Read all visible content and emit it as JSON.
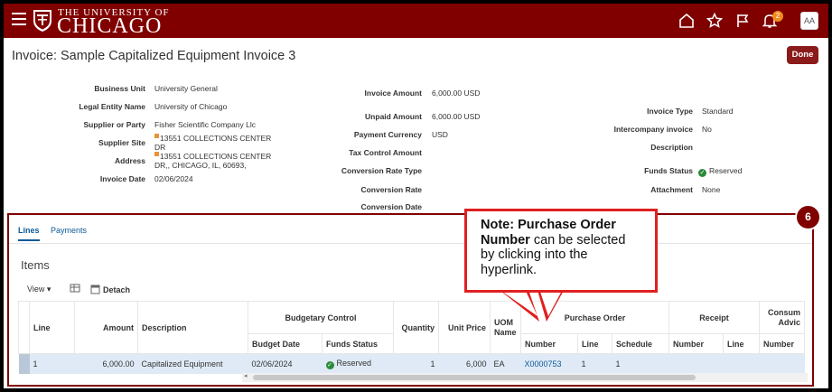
{
  "header": {
    "brand_top": "THE UNIVERSITY OF",
    "brand_main": "CHICAGO",
    "notification_count": "2",
    "avatar_initials": "AA",
    "brand_color": "#800000"
  },
  "page": {
    "title": "Invoice: Sample Capitalized Equipment Invoice 3",
    "done_label": "Done"
  },
  "fields_left": {
    "business_unit_label": "Business Unit",
    "business_unit": "University General",
    "legal_entity_label": "Legal Entity Name",
    "legal_entity": "University of Chicago",
    "supplier_label": "Supplier or Party",
    "supplier": "Fisher Scientific Company Llc",
    "supplier_site_label": "Supplier Site",
    "supplier_site_1": "13551 COLLECTIONS CENTER",
    "supplier_site_2": "DR",
    "address_label": "Address",
    "address_1": "13551 COLLECTIONS CENTER",
    "address_2": "DR,, CHICAGO, IL, 60693,",
    "invoice_date_label": "Invoice Date",
    "invoice_date": "02/06/2024"
  },
  "fields_mid": {
    "invoice_amount_label": "Invoice Amount",
    "invoice_amount": "6,000.00 USD",
    "unpaid_amount_label": "Unpaid Amount",
    "unpaid_amount": "6,000.00 USD",
    "payment_currency_label": "Payment Currency",
    "payment_currency": "USD",
    "tax_control_label": "Tax Control Amount",
    "conv_rate_type_label": "Conversion Rate Type",
    "conv_rate_label": "Conversion Rate",
    "conv_date_label": "Conversion Date"
  },
  "fields_right": {
    "invoice_type_label": "Invoice Type",
    "invoice_type": "Standard",
    "intercompany_label": "Intercompany invoice",
    "intercompany": "No",
    "description_label": "Description",
    "funds_status_label": "Funds Status",
    "funds_status": "Reserved",
    "attachment_label": "Attachment",
    "attachment": "None"
  },
  "tabs": {
    "lines": "Lines",
    "payments": "Payments"
  },
  "items": {
    "title": "Items",
    "view_label": "View",
    "detach_label": "Detach",
    "headers": {
      "line": "Line",
      "amount": "Amount",
      "description": "Description",
      "budgetary_control": "Budgetary Control",
      "budget_date": "Budget Date",
      "funds_status": "Funds Status",
      "quantity": "Quantity",
      "unit_price": "Unit Price",
      "uom_name_1": "UOM",
      "uom_name_2": "Name",
      "purchase_order": "Purchase Order",
      "po_number": "Number",
      "po_line": "Line",
      "po_schedule": "Schedule",
      "receipt": "Receipt",
      "rc_number": "Number",
      "rc_line": "Line",
      "consumption_1": "Consum",
      "consumption_2": "Advic",
      "cs_number": "Number"
    },
    "row": {
      "line": "1",
      "amount": "6,000.00",
      "description": "Capitalized Equipment",
      "budget_date": "02/06/2024",
      "funds_status": "Reserved",
      "quantity": "1",
      "unit_price": "6,000",
      "uom": "EA",
      "po_number": "X0000753",
      "po_line": "1",
      "po_schedule": "1"
    }
  },
  "callout": {
    "step": "6",
    "note_bold": "Note: Purchase Order Number",
    "note_rest": " can be selected by clicking into the hyperlink."
  }
}
